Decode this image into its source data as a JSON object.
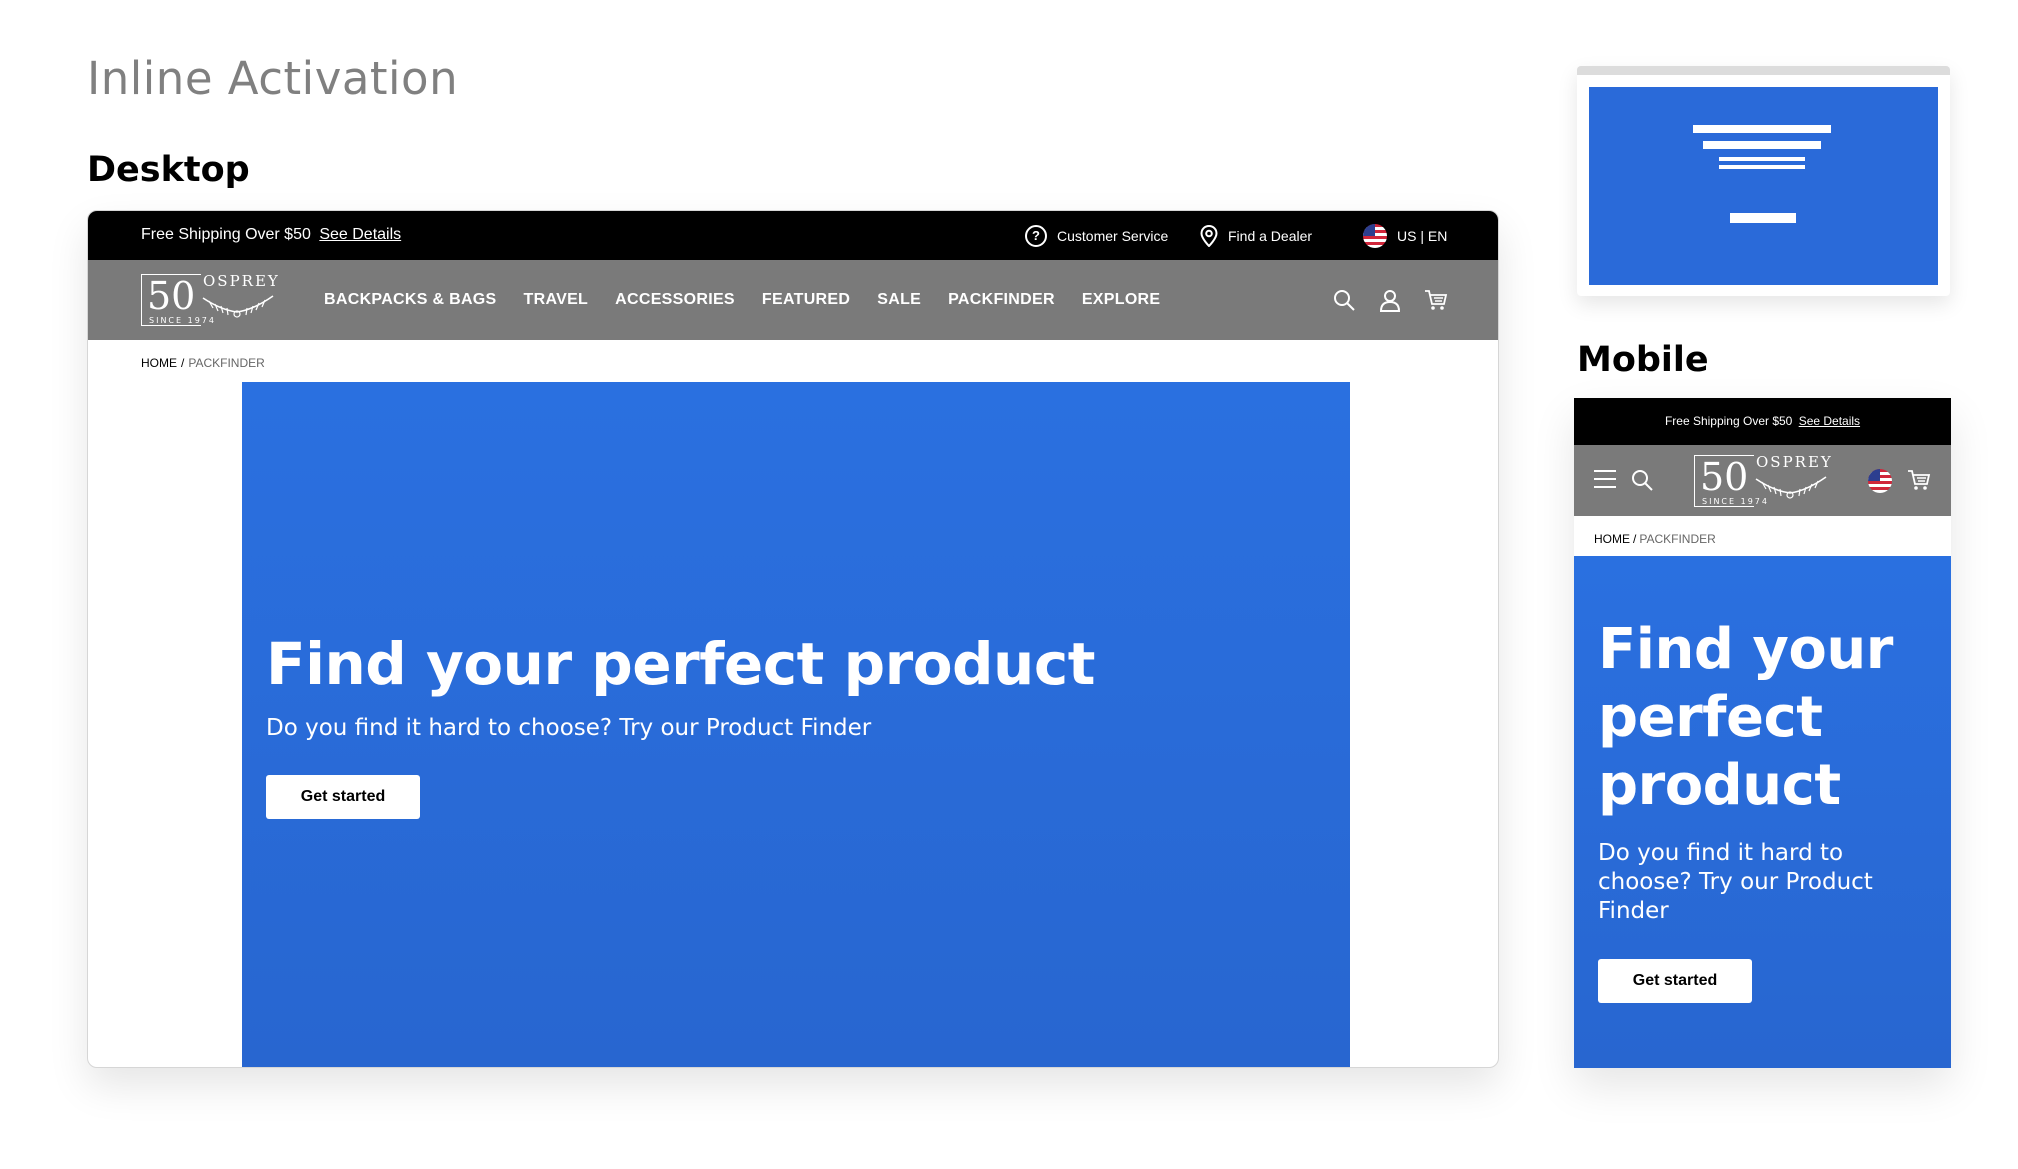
{
  "page_title": "Inline Activation",
  "sections": {
    "desktop": "Desktop",
    "mobile": "Mobile"
  },
  "topbar": {
    "shipping_text": "Free Shipping Over $50",
    "shipping_link": "See Details",
    "customer_service": "Customer Service",
    "find_dealer": "Find a Dealer",
    "locale": "US | EN"
  },
  "logo": {
    "number": "50",
    "brand": "OSPREY",
    "since": "SINCE 1974"
  },
  "nav": {
    "items": [
      "BACKPACKS & BAGS",
      "TRAVEL",
      "ACCESSORIES",
      "FEATURED",
      "SALE",
      "PACKFINDER",
      "EXPLORE"
    ]
  },
  "breadcrumb": {
    "home": "HOME",
    "separator": "/",
    "current": "PACKFINDER"
  },
  "hero": {
    "title": "Find your perfect product",
    "subtitle": "Do you find it hard to choose? Try our Product Finder",
    "cta": "Get started"
  },
  "colors": {
    "hero_blue": "#2a6ad9",
    "nav_gray": "#7a7a7a",
    "topbar_black": "#000000",
    "title_gray": "#808080"
  },
  "icons": [
    "help-circle-icon",
    "map-pin-icon",
    "us-flag-icon",
    "search-icon",
    "user-icon",
    "cart-icon",
    "hamburger-menu-icon"
  ]
}
